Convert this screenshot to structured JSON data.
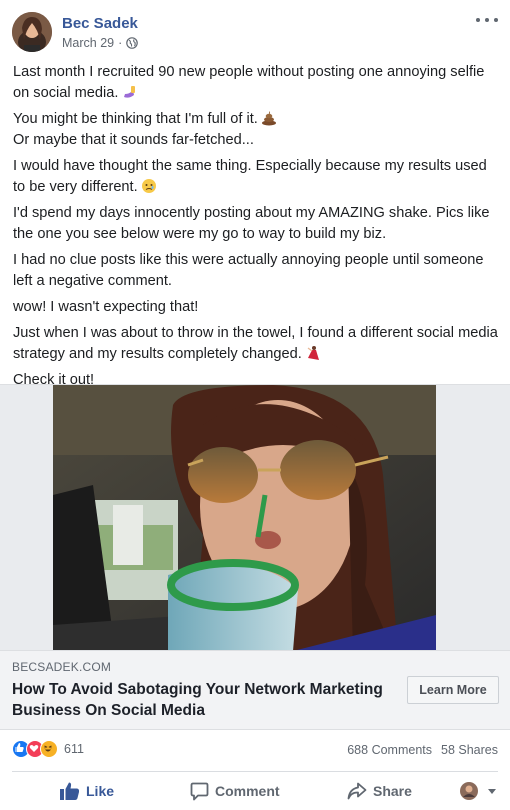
{
  "post": {
    "author": "Bec Sadek",
    "date": "March 29",
    "separator": "·",
    "paragraphs": [
      "Last month I recruited 90 new people without posting one annoying selfie on social media.",
      "You might be thinking that I'm full of it.",
      "Or maybe that it sounds far-fetched...",
      "I would have thought the same thing. Especially because my results used to be very different.",
      "I'd spend my days innocently posting about my AMAZING shake. Pics like the one you see below were my go to way to build my biz.",
      "I had no clue posts like this were actually annoying people until someone left a negative comment.",
      "wow! I wasn't expecting that!",
      "Just when I was about to throw in the towel, I found a different social media strategy and my results completely changed.",
      "Check it out!"
    ]
  },
  "link_card": {
    "domain": "BECSADEK.COM",
    "headline": "How To Avoid Sabotaging Your Network Marketing Business On Social Media",
    "cta": "Learn More"
  },
  "engagement": {
    "reaction_count": "611",
    "comments": "688 Comments",
    "shares": "58 Shares"
  },
  "actions": {
    "like": "Like",
    "comment": "Comment",
    "share": "Share"
  },
  "colors": {
    "brand_blue": "#385898",
    "like_blue": "#1877f2",
    "love_red": "#f33e58",
    "haha_yellow": "#f7b125"
  }
}
